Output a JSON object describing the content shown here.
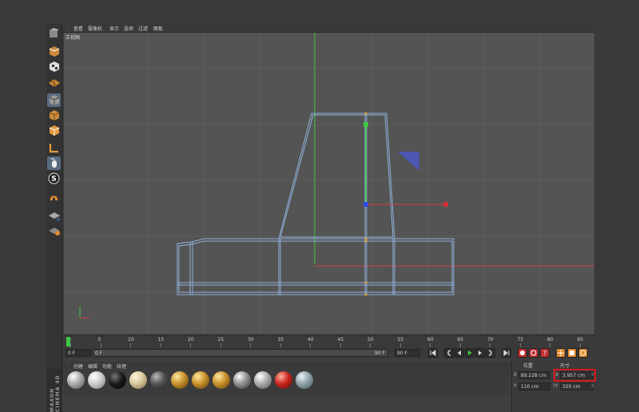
{
  "viewport": {
    "menu": [
      "查看",
      "摄像机",
      "显示",
      "选项",
      "过滤",
      "面板"
    ],
    "view_label": "正视图"
  },
  "timeline": {
    "ticks": [
      "0",
      "5",
      "10",
      "15",
      "20",
      "25",
      "30",
      "35",
      "40",
      "45",
      "50",
      "55",
      "60",
      "65",
      "70",
      "75",
      "80",
      "85"
    ],
    "start_frame": "0 F",
    "current_frame": "0 F",
    "range_end": "90 F",
    "end_frame": "90 F"
  },
  "materials": {
    "menu": [
      "创建",
      "编辑",
      "功能",
      "纹理"
    ],
    "swatches": [
      "silver",
      "white",
      "black",
      "cream",
      "dark-gray",
      "gold",
      "gold",
      "gold",
      "chrome",
      "silver",
      "red",
      "glass"
    ]
  },
  "brand": {
    "text": "MAXON CINEMA 4D"
  },
  "coordinates": {
    "position_header": "位置",
    "size_header": "尺寸",
    "pos_x_label": "X",
    "pos_x_value": "89.228 cm",
    "pos_y_label": "Y",
    "pos_y_value": "110 cm",
    "size_x_label": "X",
    "size_x_value": "3.957 cm",
    "size_y_label": "Y",
    "size_y_value": "320 cm"
  },
  "colors": {
    "highlight": "#d8191e",
    "wire": "#8fb0dc",
    "x_axis": "#e04040",
    "y_axis": "#40d040",
    "z_axis": "#4040e0"
  }
}
